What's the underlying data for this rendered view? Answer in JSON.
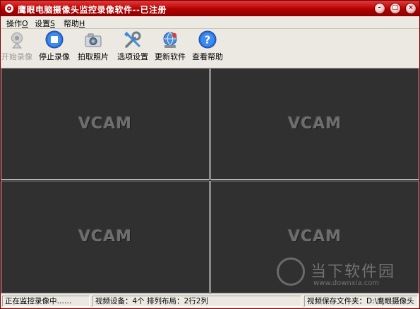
{
  "window": {
    "title": "鹰眼电脑摄像头监控录像软件--已注册",
    "controls": {
      "minimize": "–",
      "maximize": "□",
      "close": "×"
    }
  },
  "menu": [
    {
      "label": "操作",
      "accel": "O"
    },
    {
      "label": "设置",
      "accel": "S"
    },
    {
      "label": "帮助",
      "accel": "H"
    }
  ],
  "toolbar": {
    "start_record": {
      "label": "开始录像",
      "icon": "webcam-icon",
      "enabled": false
    },
    "stop_record": {
      "label": "停止录像",
      "icon": "stop-icon",
      "enabled": true
    },
    "snapshot": {
      "label": "拍取照片",
      "icon": "camera-icon",
      "enabled": true
    },
    "options": {
      "label": "选项设置",
      "icon": "tools-icon",
      "enabled": true
    },
    "update": {
      "label": "更新软件",
      "icon": "globe-update-icon",
      "enabled": true
    },
    "help": {
      "label": "查看帮助",
      "icon": "help-icon",
      "enabled": true
    }
  },
  "video_panes": [
    {
      "label": "VCAM"
    },
    {
      "label": "VCAM"
    },
    {
      "label": "VCAM"
    },
    {
      "label": "VCAM"
    }
  ],
  "watermark": {
    "title": "当下软件园",
    "url": "www.downxia.com"
  },
  "status": {
    "state": "正在监控录像中……",
    "devices": "视频设备：4个 排列布局：2行2列",
    "save_folder": "视频保存文件夹：D:\\鹰眼摄像头"
  },
  "colors": {
    "titlebar": "#b30000",
    "video_bg": "#303030",
    "chrome": "#ece9e2"
  }
}
